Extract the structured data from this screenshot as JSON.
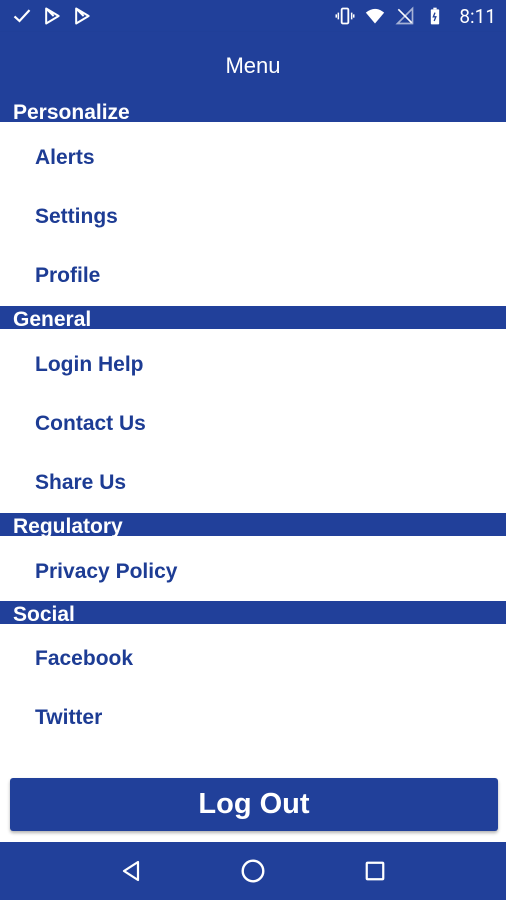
{
  "status_bar": {
    "time": "8:11",
    "left_icons": [
      "check-icon",
      "play-store-icon",
      "play-store-icon"
    ],
    "right_icons": [
      "vibrate-icon",
      "wifi-icon",
      "no-signal-icon",
      "battery-icon"
    ]
  },
  "app_bar": {
    "title": "Menu"
  },
  "sections": [
    {
      "header": "Personalize",
      "items": [
        {
          "label": "Alerts"
        },
        {
          "label": "Settings"
        },
        {
          "label": "Profile"
        }
      ]
    },
    {
      "header": "General",
      "items": [
        {
          "label": "Login Help"
        },
        {
          "label": "Contact Us"
        },
        {
          "label": "Share Us"
        }
      ]
    },
    {
      "header": "Regulatory",
      "items": [
        {
          "label": "Privacy Policy"
        }
      ]
    },
    {
      "header": "Social",
      "items": [
        {
          "label": "Facebook"
        },
        {
          "label": "Twitter"
        }
      ]
    }
  ],
  "logout_button": {
    "label": "Log Out"
  },
  "nav_bar": {
    "buttons": [
      "back-icon",
      "home-icon",
      "recents-icon"
    ]
  },
  "colors": {
    "primary": "#21409a",
    "item_text": "#1d3c94",
    "background": "#ffffff"
  }
}
